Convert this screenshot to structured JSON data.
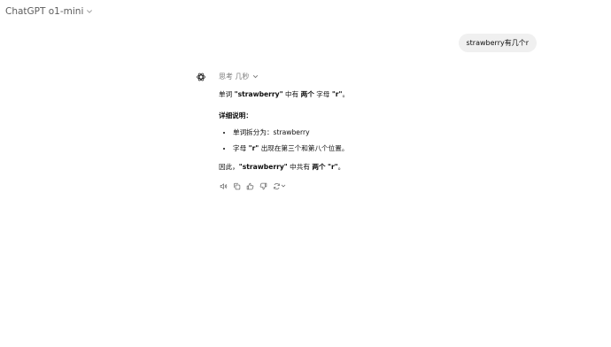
{
  "header": {
    "title": "ChatGPT o1-mini"
  },
  "user_message": "strawberry有几个r",
  "assistant": {
    "thinking_label": "思考 几秒",
    "p1": {
      "a": "单词 ",
      "b": "\"strawberry\"",
      "c": " 中有 ",
      "d": "两个",
      "e": " 字母 ",
      "f": "\"r\"",
      "g": "。"
    },
    "details_heading": "详细说明：",
    "bullets": [
      {
        "a": "单词拆分为：strawberry"
      },
      {
        "a": "字母 ",
        "b": "\"r\"",
        "c": " 出现在第三个和第八个位置。"
      }
    ],
    "conclusion": {
      "a": "因此，",
      "b": "\"strawberry\"",
      "c": " 中共有 ",
      "d": "两个",
      "e": " ",
      "f": "\"r\"",
      "g": "。"
    }
  },
  "icons": [
    "chevron-down-icon",
    "openai-logo-icon",
    "speaker-icon",
    "copy-icon",
    "thumbs-up-icon",
    "thumbs-down-icon",
    "regenerate-icon"
  ]
}
